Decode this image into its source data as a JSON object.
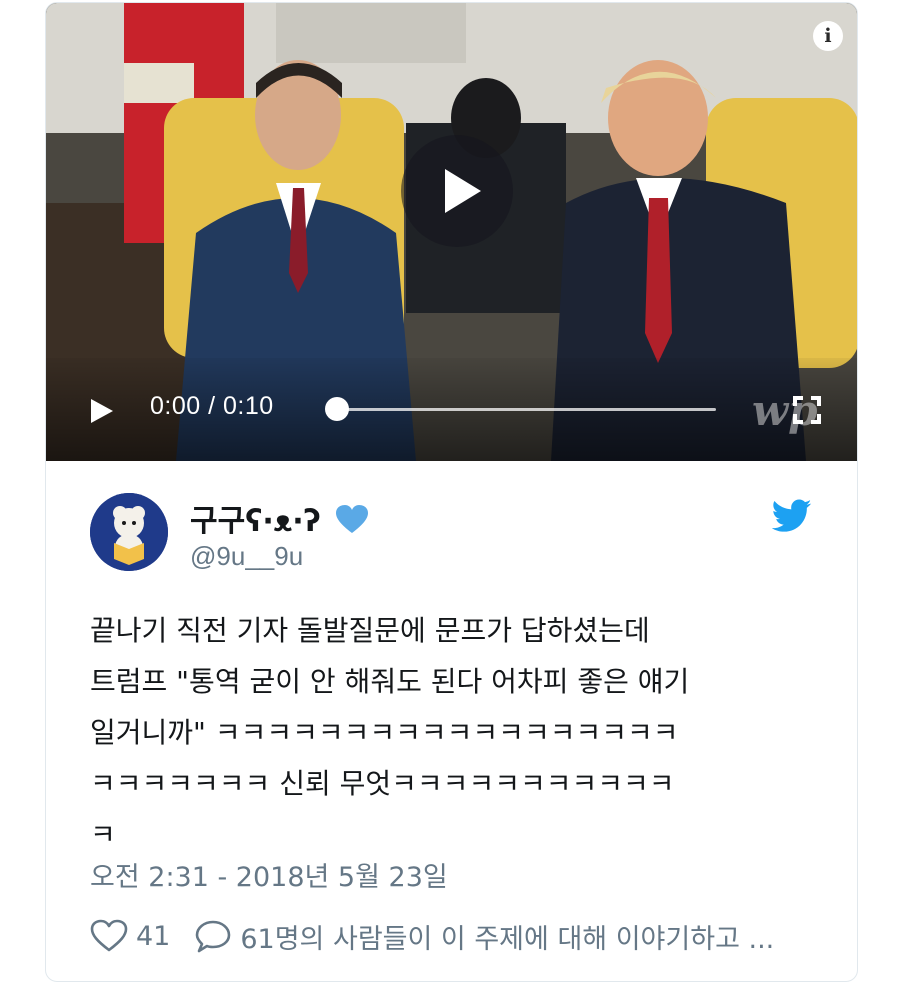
{
  "video": {
    "time_display": "0:00 / 0:10",
    "progress": 0,
    "watermark": "wp",
    "icons": [
      "info-icon",
      "play-icon",
      "fullscreen-icon"
    ]
  },
  "tweet": {
    "display_name": "구구ʕ·ᴥ·ʔ",
    "handle": "@9u__9u",
    "text": "끝나기 직전 기자 돌발질문에 문프가 답하셨는데\n트럼프 \"통역 굳이 안 해줘도 된다 어차피 좋은 얘기\n일거니까\" ㅋㅋㅋㅋㅋㅋㅋㅋㅋㅋㅋㅋㅋㅋㅋㅋㅋㅋ\nㅋㅋㅋㅋㅋㅋㅋ 신뢰 무엇ㅋㅋㅋㅋㅋㅋㅋㅋㅋㅋㅋ\nㅋ",
    "date": "오전 2:31 - 2018년 5월 23일",
    "likes": "41",
    "talking": "61명의 사람들이 이 주제에 대해 이야기하고 ..."
  },
  "colors": {
    "twitter_blue": "#1da1f2",
    "heart_blue": "#5aa9e6",
    "text_primary": "#14171a",
    "text_secondary": "#657786",
    "avatar_bg": "#1f3a8a"
  }
}
